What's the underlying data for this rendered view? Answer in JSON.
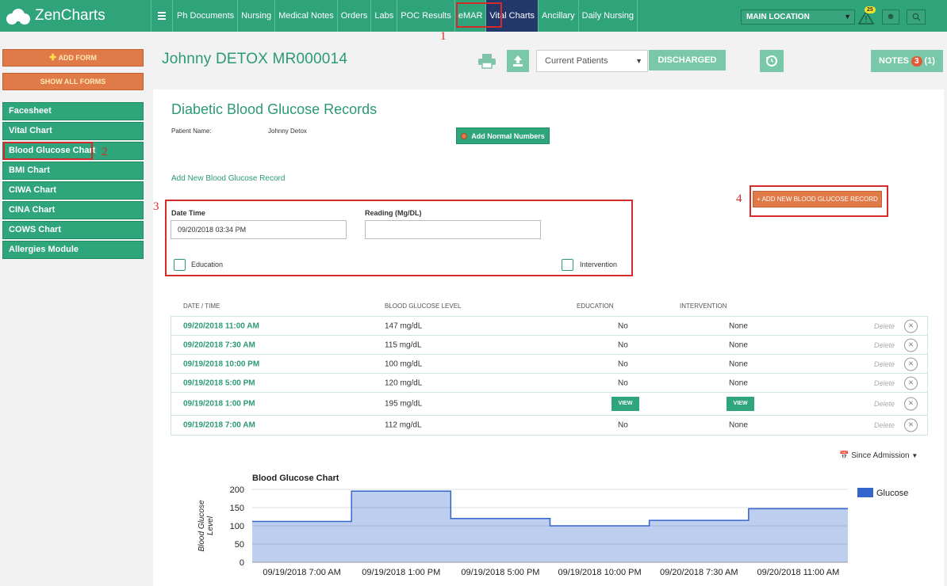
{
  "app": {
    "logo_text": "ZenCharts"
  },
  "nav": {
    "tabs": [
      {
        "label": "Ph Documents"
      },
      {
        "label": "Nursing"
      },
      {
        "label": "Medical Notes"
      },
      {
        "label": "Orders"
      },
      {
        "label": "Labs"
      },
      {
        "label": "POC Results"
      },
      {
        "label": "eMAR"
      },
      {
        "label": "Vital Charts",
        "active": true
      },
      {
        "label": "Ancillary"
      },
      {
        "label": "Daily Nursing"
      }
    ],
    "location": "MAIN LOCATION",
    "alert_count": "25"
  },
  "sidebar": {
    "add_form": "ADD FORM",
    "show_all_forms": "SHOW ALL FORMS",
    "items": [
      {
        "label": "Facesheet"
      },
      {
        "label": "Vital Chart"
      },
      {
        "label": "Blood Glucose Chart"
      },
      {
        "label": "BMI Chart"
      },
      {
        "label": "CIWA Chart"
      },
      {
        "label": "CINA Chart"
      },
      {
        "label": "COWS Chart"
      },
      {
        "label": "Allergies Module"
      }
    ]
  },
  "header": {
    "patient_title": "Johnny DETOX MR000014",
    "patient_filter": "Current Patients",
    "discharged_label": "DISCHARGED",
    "notes_label": "NOTES",
    "notes_badge": "3",
    "notes_count": "(1)"
  },
  "form": {
    "title": "Diabetic Blood Glucose Records",
    "patient_name_label": "Patient Name:",
    "patient_name_value": "Johnny Detox",
    "add_normal_numbers": "Add Normal Numbers",
    "add_record_link": "Add New Blood Glucose Record",
    "date_time_label": "Date Time",
    "date_time_value": "09/20/2018 03:34 PM",
    "reading_label": "Reading (Mg/DL)",
    "reading_value": "",
    "education_label": "Education",
    "intervention_label": "Intervention",
    "add_record_button": "+ ADD NEW BLOOD GLUCOSE RECORD"
  },
  "annotations": {
    "n1": "1",
    "n2": "2",
    "n3": "3",
    "n4": "4"
  },
  "colors": {
    "primary": "#2ea57b",
    "accent_orange": "#e07a48",
    "active_tab": "#22386a",
    "annotation_red": "#d42a2a"
  },
  "table": {
    "headers": [
      "DATE / TIME",
      "BLOOD GLUCOSE LEVEL",
      "EDUCATION",
      "INTERVENTION"
    ],
    "delete_label": "Delete",
    "view_label": "VIEW",
    "rows": [
      {
        "date": "09/20/2018 11:00 AM",
        "level": "147 mg/dL",
        "education": "No",
        "intervention": "None"
      },
      {
        "date": "09/20/2018 7:30 AM",
        "level": "115 mg/dL",
        "education": "No",
        "intervention": "None"
      },
      {
        "date": "09/19/2018 10:00 PM",
        "level": "100 mg/dL",
        "education": "No",
        "intervention": "None"
      },
      {
        "date": "09/19/2018 5:00 PM",
        "level": "120 mg/dL",
        "education": "No",
        "intervention": "None"
      },
      {
        "date": "09/19/2018 1:00 PM",
        "level": "195 mg/dL",
        "education": "VIEW",
        "intervention": "VIEW"
      },
      {
        "date": "09/19/2018 7:00 AM",
        "level": "112 mg/dL",
        "education": "No",
        "intervention": "None"
      }
    ]
  },
  "range_selector": "Since Admission",
  "chart_data": {
    "type": "area",
    "title": "Blood Glucose Chart",
    "ylabel": "Blood Glucose Level",
    "xlabel": "",
    "x": [
      "09/19/2018 7:00 AM",
      "09/19/2018 1:00 PM",
      "09/19/2018 5:00 PM",
      "09/19/2018 10:00 PM",
      "09/20/2018 7:30 AM",
      "09/20/2018 11:00 AM"
    ],
    "series": [
      {
        "name": "Glucose",
        "values": [
          112,
          195,
          120,
          100,
          115,
          147
        ],
        "color": "#3366cc"
      }
    ],
    "ylim": [
      0,
      200
    ],
    "yticks": [
      0,
      50,
      100,
      150,
      200
    ],
    "grid": true,
    "legend": "right",
    "step": true
  }
}
